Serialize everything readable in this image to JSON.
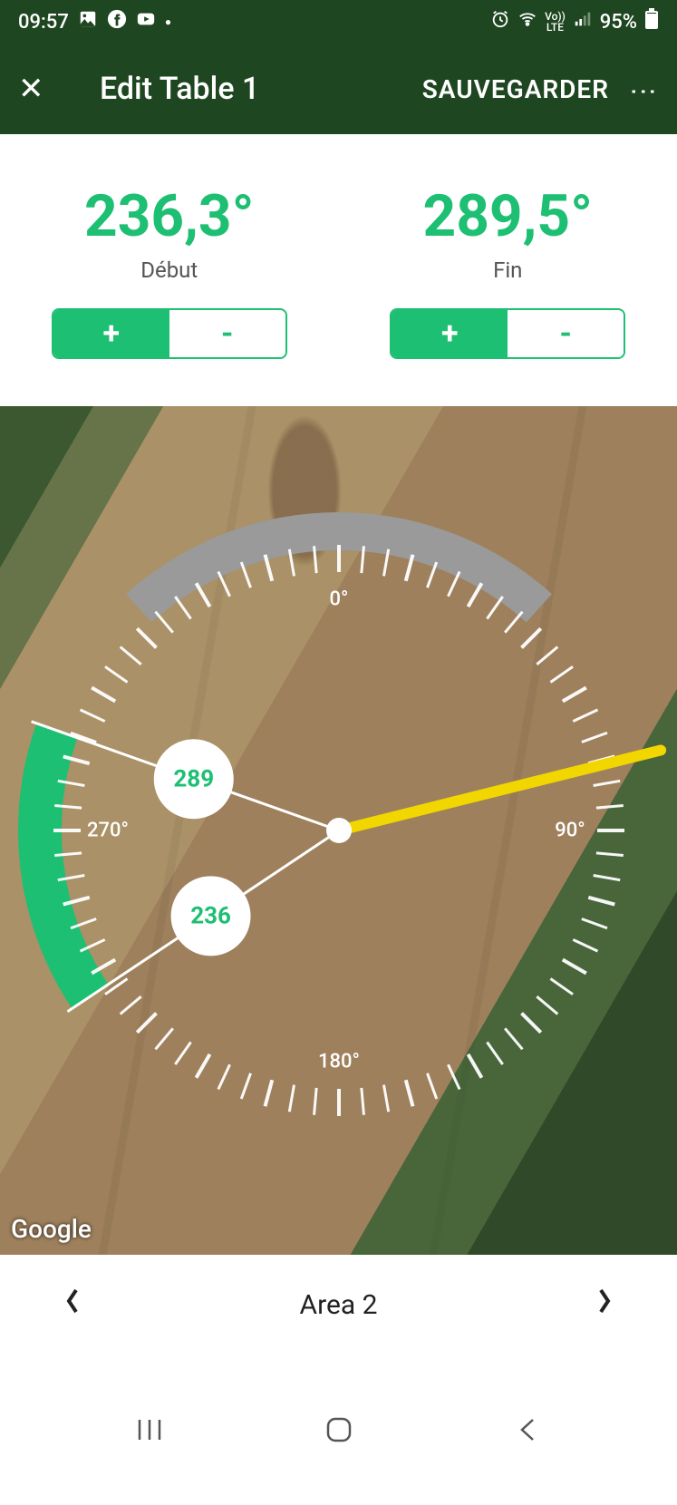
{
  "status": {
    "time": "09:57",
    "battery": "95%"
  },
  "appbar": {
    "title": "Edit Table 1",
    "save": "SAUVEGARDER"
  },
  "controls": {
    "start": {
      "value": "236,3°",
      "label": "Début",
      "plus": "+",
      "minus": "-"
    },
    "end": {
      "value": "289,5°",
      "label": "Fin",
      "plus": "+",
      "minus": "-"
    }
  },
  "dial": {
    "start_deg": 236.3,
    "end_deg": 289.5,
    "pointer_deg": 76,
    "handle_start_label": "236",
    "handle_end_label": "289",
    "cardinals": {
      "n": "0°",
      "e": "90°",
      "s": "180°",
      "w": "270°"
    }
  },
  "map": {
    "attribution": "Google"
  },
  "footer": {
    "area_label": "Area 2"
  },
  "colors": {
    "accent": "#1dbf73",
    "bar": "#1e4620",
    "pointer": "#f2d600",
    "inactive_arc": "#9a9a9a"
  }
}
